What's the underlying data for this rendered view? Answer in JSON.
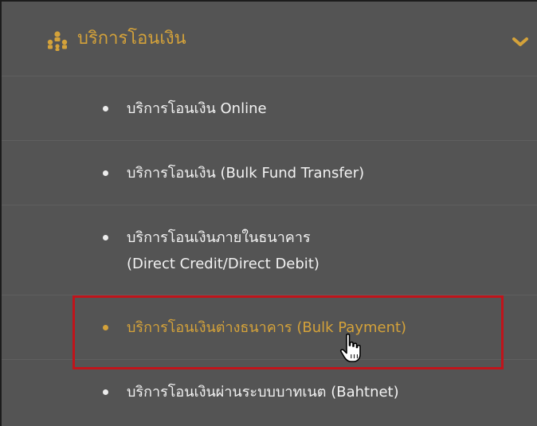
{
  "menu": {
    "section_title": "บริการโอนเงิน",
    "section_icon": "network-icon",
    "chevron_icon": "chevron-down-icon",
    "items": [
      {
        "label_line1": "บริการโอนเงิน Online",
        "label_line2": "",
        "active": false
      },
      {
        "label_line1": "บริการโอนเงิน (Bulk Fund Transfer)",
        "label_line2": "",
        "active": false
      },
      {
        "label_line1": "บริการโอนเงินภายในธนาคาร",
        "label_line2": "(Direct Credit/Direct Debit)",
        "active": false
      },
      {
        "label_line1": "บริการโอนเงินต่างธนาคาร (Bulk Payment)",
        "label_line2": "",
        "active": true
      },
      {
        "label_line1": "บริการโอนเงินผ่านระบบบาทเนต (Bahtnet)",
        "label_line2": "",
        "active": false
      }
    ]
  },
  "colors": {
    "background": "#545454",
    "accent": "#d4a23a",
    "text": "#f2f2f2",
    "highlight_border": "#c0141b"
  },
  "cursor_icon": "hand-pointer-icon"
}
